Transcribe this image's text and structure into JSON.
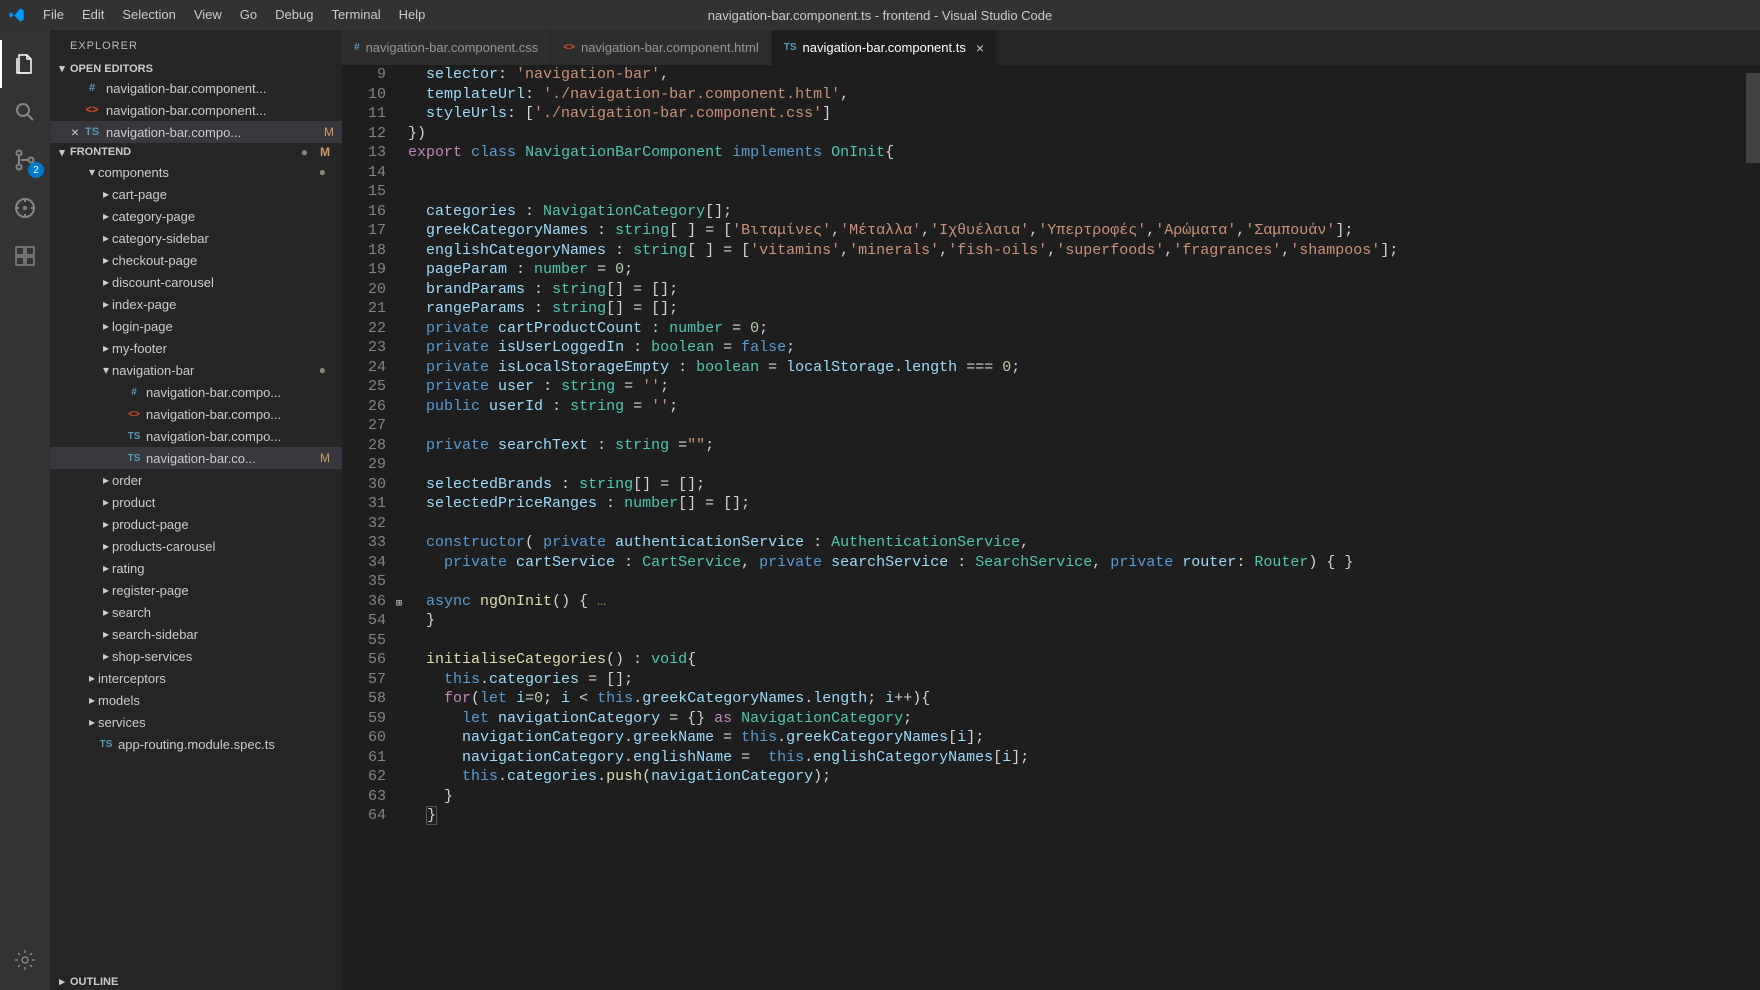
{
  "titlebar": {
    "menu": [
      "File",
      "Edit",
      "Selection",
      "View",
      "Go",
      "Debug",
      "Terminal",
      "Help"
    ],
    "title": "navigation-bar.component.ts - frontend - Visual Studio Code"
  },
  "activitybar": {
    "icons": [
      {
        "name": "explorer",
        "active": true
      },
      {
        "name": "search",
        "active": false
      },
      {
        "name": "scm",
        "active": false,
        "badge": "2"
      },
      {
        "name": "debug",
        "active": false
      },
      {
        "name": "extensions",
        "active": false
      }
    ]
  },
  "sidebar": {
    "title": "EXPLORER",
    "open_editors_label": "OPEN EDITORS",
    "open_editors": [
      {
        "icon": "css",
        "label": "navigation-bar.component...",
        "close": false
      },
      {
        "icon": "html",
        "label": "navigation-bar.component...",
        "close": false
      },
      {
        "icon": "ts",
        "label": "navigation-bar.compo...",
        "close": true,
        "status": "M",
        "selected": true
      }
    ],
    "frontend_label": "FRONTEND",
    "frontend_status_dot": "●",
    "frontend_m": "M",
    "tree": [
      {
        "indent": 2,
        "chev": "▾",
        "label": "components",
        "dot": true
      },
      {
        "indent": 3,
        "chev": "▸",
        "label": "cart-page"
      },
      {
        "indent": 3,
        "chev": "▸",
        "label": "category-page"
      },
      {
        "indent": 3,
        "chev": "▸",
        "label": "category-sidebar"
      },
      {
        "indent": 3,
        "chev": "▸",
        "label": "checkout-page"
      },
      {
        "indent": 3,
        "chev": "▸",
        "label": "discount-carousel"
      },
      {
        "indent": 3,
        "chev": "▸",
        "label": "index-page"
      },
      {
        "indent": 3,
        "chev": "▸",
        "label": "login-page"
      },
      {
        "indent": 3,
        "chev": "▸",
        "label": "my-footer"
      },
      {
        "indent": 3,
        "chev": "▾",
        "label": "navigation-bar",
        "dot": true
      },
      {
        "indent": 4,
        "icon": "css",
        "label": "navigation-bar.compo..."
      },
      {
        "indent": 4,
        "icon": "html",
        "label": "navigation-bar.compo..."
      },
      {
        "indent": 4,
        "icon": "ts",
        "label": "navigation-bar.compo..."
      },
      {
        "indent": 4,
        "icon": "ts",
        "label": "navigation-bar.co...",
        "status": "M",
        "selected": true
      },
      {
        "indent": 3,
        "chev": "▸",
        "label": "order"
      },
      {
        "indent": 3,
        "chev": "▸",
        "label": "product"
      },
      {
        "indent": 3,
        "chev": "▸",
        "label": "product-page"
      },
      {
        "indent": 3,
        "chev": "▸",
        "label": "products-carousel"
      },
      {
        "indent": 3,
        "chev": "▸",
        "label": "rating"
      },
      {
        "indent": 3,
        "chev": "▸",
        "label": "register-page"
      },
      {
        "indent": 3,
        "chev": "▸",
        "label": "search"
      },
      {
        "indent": 3,
        "chev": "▸",
        "label": "search-sidebar"
      },
      {
        "indent": 3,
        "chev": "▸",
        "label": "shop-services"
      },
      {
        "indent": 2,
        "chev": "▸",
        "label": "interceptors"
      },
      {
        "indent": 2,
        "chev": "▸",
        "label": "models"
      },
      {
        "indent": 2,
        "chev": "▸",
        "label": "services"
      },
      {
        "indent": 2,
        "icon": "ts",
        "label": "app-routing.module.spec.ts"
      }
    ],
    "outline_label": "OUTLINE"
  },
  "tabs": [
    {
      "icon": "css",
      "label": "navigation-bar.component.css",
      "active": false
    },
    {
      "icon": "html",
      "label": "navigation-bar.component.html",
      "active": false
    },
    {
      "icon": "ts",
      "label": "navigation-bar.component.ts",
      "active": true,
      "close": true
    }
  ],
  "code": {
    "lines": [
      {
        "n": "9",
        "html": "  <span class='t-var'>selector</span>: <span class='t-str'>'navigation-bar'</span>,"
      },
      {
        "n": "10",
        "html": "  <span class='t-var'>templateUrl</span>: <span class='t-str'>'./navigation-bar.component.html'</span>,"
      },
      {
        "n": "11",
        "html": "  <span class='t-var'>styleUrls</span>: [<span class='t-str'>'./navigation-bar.component.css'</span>]"
      },
      {
        "n": "12",
        "html": "})"
      },
      {
        "n": "13",
        "html": "<span class='t-kw2'>export</span> <span class='t-kw'>class</span> <span class='t-cls'>NavigationBarComponent</span> <span class='t-kw'>implements</span> <span class='t-cls'>OnInit</span>{"
      },
      {
        "n": "14",
        "html": ""
      },
      {
        "n": "15",
        "html": ""
      },
      {
        "n": "16",
        "html": "  <span class='t-var'>categories</span> : <span class='t-cls'>NavigationCategory</span>[];"
      },
      {
        "n": "17",
        "html": "  <span class='t-var'>greekCategoryNames</span> : <span class='t-cls'>string</span>[ ] = [<span class='t-str'>'Βιταμίνες'</span>,<span class='t-str'>'Μέταλλα'</span>,<span class='t-str'>'Ιχθυέλαια'</span>,<span class='t-str'>'Υπερτροφές'</span>,<span class='t-str'>'Αρώματα'</span>,<span class='t-str'>'Σαμπουάν'</span>];"
      },
      {
        "n": "18",
        "html": "  <span class='t-var'>englishCategoryNames</span> : <span class='t-cls'>string</span>[ ] = [<span class='t-str'>'vitamins'</span>,<span class='t-str'>'minerals'</span>,<span class='t-str'>'fish-oils'</span>,<span class='t-str'>'superfoods'</span>,<span class='t-str'>'fragrances'</span>,<span class='t-str'>'shampoos'</span>];"
      },
      {
        "n": "19",
        "html": "  <span class='t-var'>pageParam</span> : <span class='t-cls'>number</span> = <span class='t-num'>0</span>;"
      },
      {
        "n": "20",
        "html": "  <span class='t-var'>brandParams</span> : <span class='t-cls'>string</span>[] = [];"
      },
      {
        "n": "21",
        "html": "  <span class='t-var'>rangeParams</span> : <span class='t-cls'>string</span>[] = [];"
      },
      {
        "n": "22",
        "html": "  <span class='t-kw'>private</span> <span class='t-var'>cartProductCount</span> : <span class='t-cls'>number</span> = <span class='t-num'>0</span>;"
      },
      {
        "n": "23",
        "html": "  <span class='t-kw'>private</span> <span class='t-var'>isUserLoggedIn</span> : <span class='t-cls'>boolean</span> = <span class='t-kw'>false</span>;"
      },
      {
        "n": "24",
        "html": "  <span class='t-kw'>private</span> <span class='t-var'>isLocalStorageEmpty</span> : <span class='t-cls'>boolean</span> = <span class='t-var'>localStorage</span>.<span class='t-var'>length</span> === <span class='t-num'>0</span>;"
      },
      {
        "n": "25",
        "html": "  <span class='t-kw'>private</span> <span class='t-var'>user</span> : <span class='t-cls'>string</span> = <span class='t-str'>''</span>;"
      },
      {
        "n": "26",
        "html": "  <span class='t-kw'>public</span> <span class='t-var'>userId</span> : <span class='t-cls'>string</span> = <span class='t-str'>''</span>;"
      },
      {
        "n": "27",
        "html": ""
      },
      {
        "n": "28",
        "html": "  <span class='t-kw'>private</span> <span class='t-var'>searchText</span> : <span class='t-cls'>string</span> =<span class='t-str'>\"\"</span>;"
      },
      {
        "n": "29",
        "html": ""
      },
      {
        "n": "30",
        "html": "  <span class='t-var'>selectedBrands</span> : <span class='t-cls'>string</span>[] = [];"
      },
      {
        "n": "31",
        "html": "  <span class='t-var'>selectedPriceRanges</span> : <span class='t-cls'>number</span>[] = [];"
      },
      {
        "n": "32",
        "html": ""
      },
      {
        "n": "33",
        "html": "  <span class='t-kw'>constructor</span>( <span class='t-kw'>private</span> <span class='t-var'>authenticationService</span> : <span class='t-cls'>AuthenticationService</span>,"
      },
      {
        "n": "34",
        "html": "    <span class='t-kw'>private</span> <span class='t-var'>cartService</span> : <span class='t-cls'>CartService</span>, <span class='t-kw'>private</span> <span class='t-var'>searchService</span> : <span class='t-cls'>SearchService</span>, <span class='t-kw'>private</span> <span class='t-var'>router</span>: <span class='t-cls'>Router</span>) { }"
      },
      {
        "n": "35",
        "html": ""
      },
      {
        "n": "36",
        "html": "  <span class='t-kw'>async</span> <span class='t-fn'>ngOnInit</span>() {<span class='t-cmt'> …</span>",
        "fold": "⊞"
      },
      {
        "n": "54",
        "html": "  }"
      },
      {
        "n": "55",
        "html": ""
      },
      {
        "n": "56",
        "html": "  <span class='t-fn'>initialiseCategories</span>() : <span class='t-cls'>void</span>{"
      },
      {
        "n": "57",
        "html": "    <span class='t-kw'>this</span>.<span class='t-var'>categories</span> = [];"
      },
      {
        "n": "58",
        "html": "    <span class='t-kw2'>for</span>(<span class='t-kw'>let</span> <span class='t-var'>i</span>=<span class='t-num'>0</span>; <span class='t-var'>i</span> &lt; <span class='t-kw'>this</span>.<span class='t-var'>greekCategoryNames</span>.<span class='t-var'>length</span>; <span class='t-var'>i</span>++){"
      },
      {
        "n": "59",
        "html": "      <span class='t-kw'>let</span> <span class='t-var'>navigationCategory</span> = {} <span class='t-kw2'>as</span> <span class='t-cls'>NavigationCategory</span>;"
      },
      {
        "n": "60",
        "html": "      <span class='t-var'>navigationCategory</span>.<span class='t-var'>greekName</span> = <span class='t-kw'>this</span>.<span class='t-var'>greekCategoryNames</span>[<span class='t-var'>i</span>];"
      },
      {
        "n": "61",
        "html": "      <span class='t-var'>navigationCategory</span>.<span class='t-var'>englishName</span> =  <span class='t-kw'>this</span>.<span class='t-var'>englishCategoryNames</span>[<span class='t-var'>i</span>];"
      },
      {
        "n": "62",
        "html": "      <span class='t-kw'>this</span>.<span class='t-var'>categories</span>.<span class='t-fn'>push</span>(<span class='t-var'>navigationCategory</span>);"
      },
      {
        "n": "63",
        "html": "    }"
      },
      {
        "n": "64",
        "html": "  <span style='border:1px solid #555'>}</span>"
      }
    ]
  }
}
